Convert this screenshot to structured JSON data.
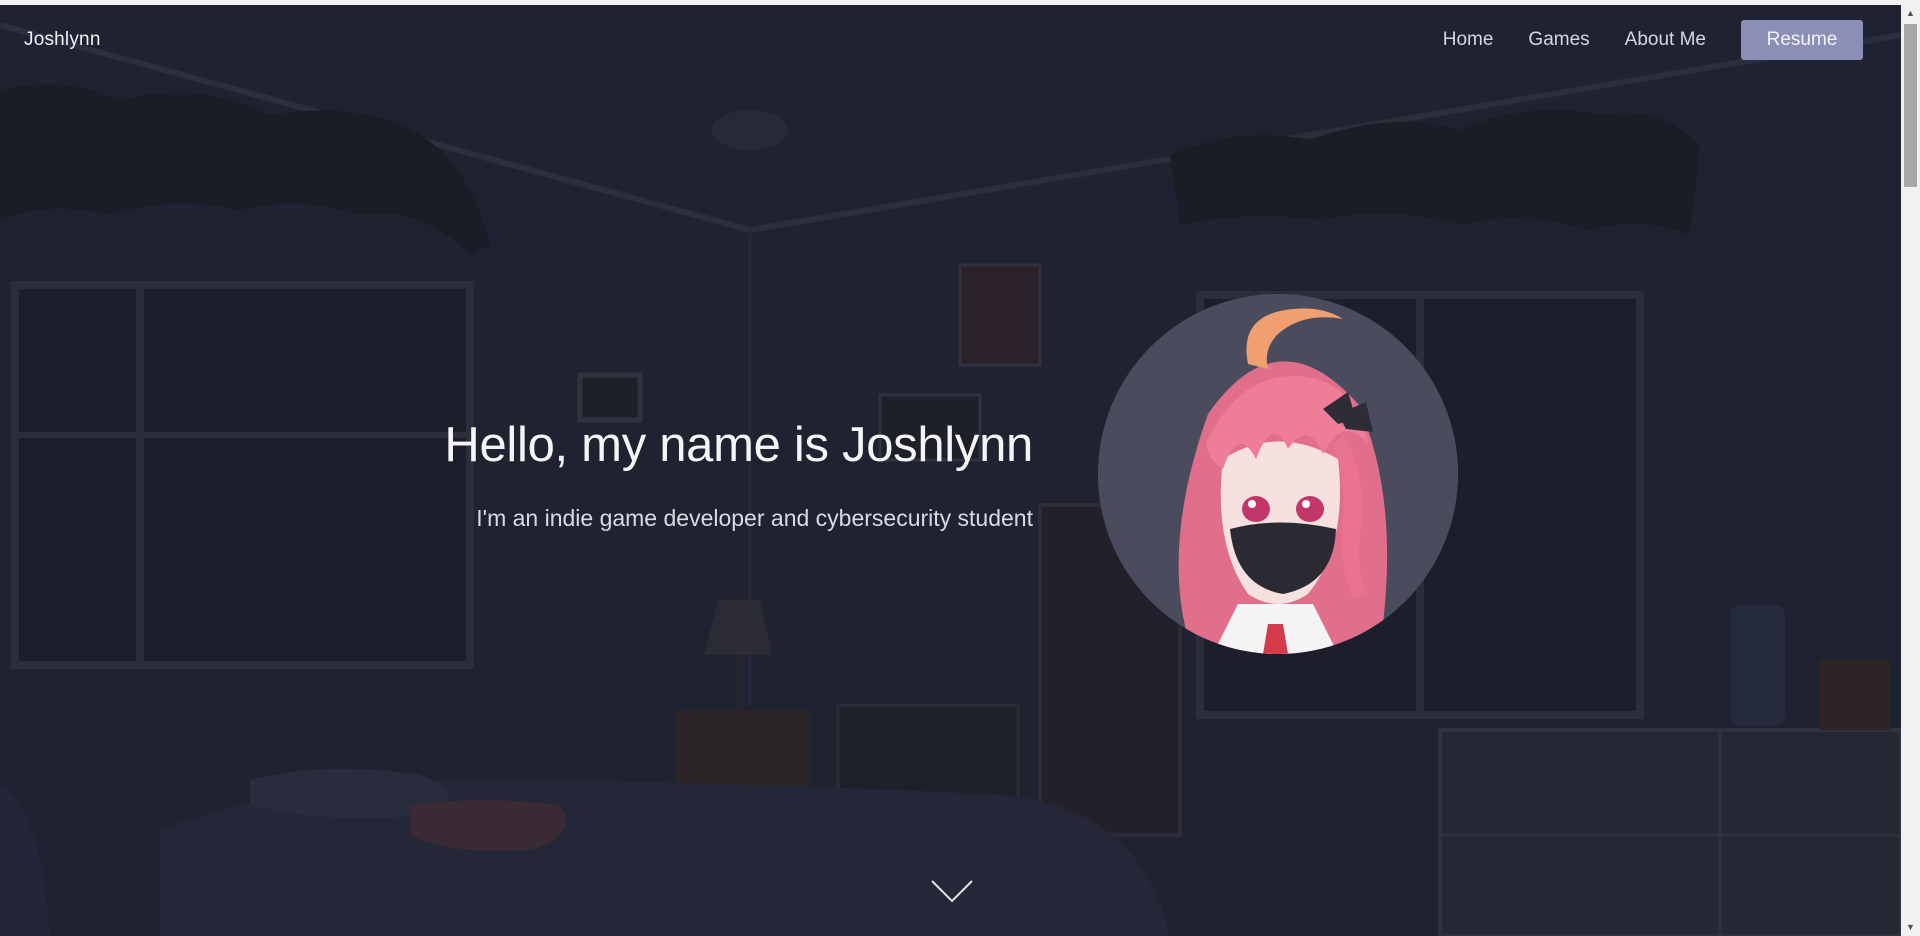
{
  "navbar": {
    "brand": "Joshlynn",
    "links": [
      {
        "label": "Home"
      },
      {
        "label": "Games"
      },
      {
        "label": "About Me"
      }
    ],
    "resume_label": "Resume"
  },
  "hero": {
    "title": "Hello, my name is Joshlynn",
    "subtitle": "I'm an indie game developer and cybersecurity student"
  },
  "icons": {
    "scroll": "chevron-down-icon",
    "scroll_up": "arrow-up-icon",
    "scroll_down": "arrow-down-icon"
  },
  "colors": {
    "background": "#1f2230",
    "accent_button": "#8b8fb5",
    "avatar_hair": "#ef7f9a"
  }
}
